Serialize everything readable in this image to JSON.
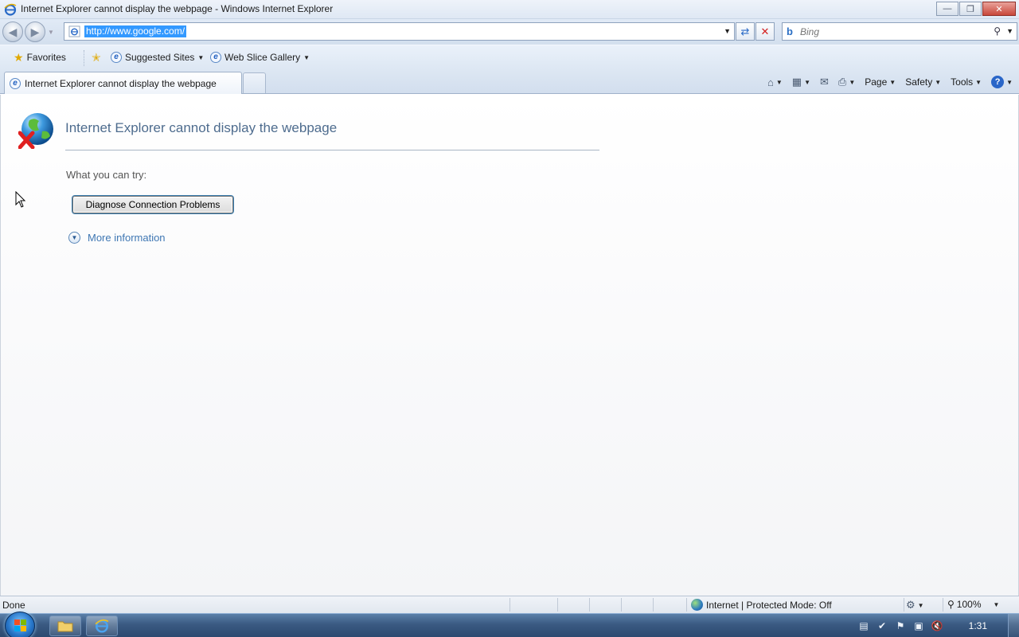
{
  "window": {
    "title": "Internet Explorer cannot display the webpage - Windows Internet Explorer",
    "minimize_icon": "minimize-icon",
    "restore_icon": "restore-icon",
    "close_icon": "close-icon"
  },
  "address_bar": {
    "url": "http://www.google.com/",
    "search_placeholder": "Bing"
  },
  "favorites_bar": {
    "favorites_label": "Favorites",
    "items": [
      {
        "label": "Suggested Sites"
      },
      {
        "label": "Web Slice Gallery"
      }
    ]
  },
  "tabs": [
    {
      "label": "Internet Explorer cannot display the webpage",
      "active": true
    }
  ],
  "command_bar": {
    "page_label": "Page",
    "safety_label": "Safety",
    "tools_label": "Tools"
  },
  "content": {
    "title": "Internet Explorer cannot display the webpage",
    "try_label": "What you can try:",
    "diagnose_button": "Diagnose Connection Problems",
    "more_info": "More information"
  },
  "status_bar": {
    "status": "Done",
    "zone": "Internet | Protected Mode: Off",
    "zoom": "100%"
  },
  "taskbar": {
    "clock": "1:31"
  },
  "colors": {
    "title_text": "#4e6c8e",
    "link": "#3f77b3",
    "url_highlight": "#3399ff"
  }
}
